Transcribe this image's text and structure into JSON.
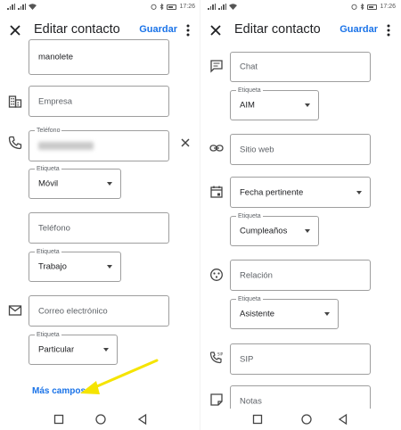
{
  "status": {
    "time": "17:26"
  },
  "left": {
    "title": "Editar contacto",
    "save_label": "Guardar",
    "apodo_value": "manolete",
    "empresa_placeholder": "Empresa",
    "telefono_label": "Teléfono",
    "telefono_etiqueta_label": "Etiqueta",
    "telefono_etiqueta_value": "Móvil",
    "telefono2_placeholder": "Teléfono",
    "telefono2_etiqueta_label": "Etiqueta",
    "telefono2_etiqueta_value": "Trabajo",
    "correo_placeholder": "Correo electrónico",
    "correo_etiqueta_label": "Etiqueta",
    "correo_etiqueta_value": "Particular",
    "more_fields_label": "Más campos"
  },
  "right": {
    "title": "Editar contacto",
    "save_label": "Guardar",
    "chat_placeholder": "Chat",
    "chat_etiqueta_label": "Etiqueta",
    "chat_etiqueta_value": "AIM",
    "web_placeholder": "Sitio web",
    "fecha_value": "Fecha pertinente",
    "fecha_etiqueta_label": "Etiqueta",
    "fecha_etiqueta_value": "Cumpleaños",
    "relacion_placeholder": "Relación",
    "relacion_etiqueta_label": "Etiqueta",
    "relacion_etiqueta_value": "Asistente",
    "sip_placeholder": "SIP",
    "notas_placeholder": "Notas"
  },
  "icons": {
    "close": "close-icon",
    "more": "more-vert-icon",
    "business": "business-icon",
    "phone": "phone-icon",
    "clear": "clear-icon",
    "email": "email-icon",
    "chat": "chat-icon",
    "link": "link-icon",
    "event": "event-icon",
    "relation": "relation-icon",
    "sip": "sip-phone-icon",
    "notes": "notes-icon",
    "recents": "square-icon",
    "home": "circle-icon",
    "back": "triangle-back-icon"
  },
  "colors": {
    "accent": "#1a73e8",
    "annotation_arrow": "#f5e400"
  }
}
